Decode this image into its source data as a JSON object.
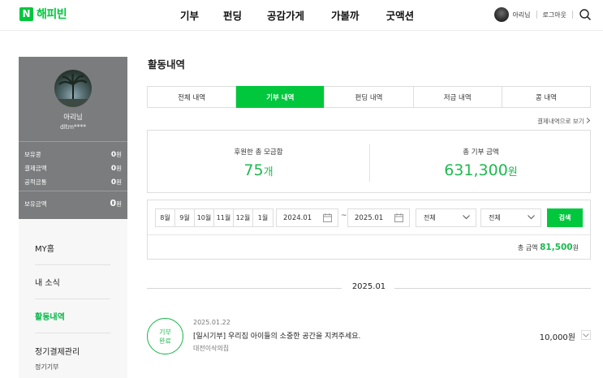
{
  "header": {
    "logo_mark": "N",
    "logo_text": "해피빈",
    "nav": [
      "기부",
      "펀딩",
      "공감가게",
      "가볼까",
      "굿액션"
    ],
    "user_name": "아리님",
    "logout_label": "로그아웃"
  },
  "profile": {
    "name": "아리님",
    "id": "dltm****",
    "stats": [
      {
        "label": "보유콩",
        "value": "0",
        "unit": "원"
      },
      {
        "label": "결제금액",
        "value": "0",
        "unit": "원"
      },
      {
        "label": "공적금통",
        "value": "0",
        "unit": "원"
      }
    ],
    "total": {
      "label": "보유금액",
      "value": "0",
      "unit": "원"
    }
  },
  "menu": {
    "items": [
      "MY홈",
      "내 소식",
      "활동내역",
      "정기결제관리"
    ],
    "active": "활동내역",
    "sub": "정기기부"
  },
  "main": {
    "title": "활동내역",
    "tabs": [
      "전체 내역",
      "기부 내역",
      "펀딩 내역",
      "저금 내역",
      "콩 내역"
    ],
    "active_tab": "기부 내역",
    "payment_link": "결제내역으로 보기",
    "summary": [
      {
        "label": "후원한 총 모금함",
        "value": "75",
        "unit": "개"
      },
      {
        "label": "총 기부 금액",
        "value": "631,300",
        "unit": "원"
      }
    ],
    "filter": {
      "months": [
        "8월",
        "9월",
        "10월",
        "11월",
        "12월",
        "1월"
      ],
      "start_date": "2024.01",
      "end_date": "2025.01",
      "tilde": "~",
      "select1": "전체",
      "select2": "전체",
      "search_label": "검색",
      "total_label": "총 금액",
      "total_value": "81,500",
      "total_unit": "원"
    },
    "month_header": "2025.01",
    "donations": [
      {
        "badge_line1": "기부",
        "badge_line2": "완료",
        "date": "2025.01.22",
        "title": "[일시기부] 우리집 아이들의 소중한 공간을 지켜주세요.",
        "org": "대전이삭의집",
        "amount": "10,000원"
      }
    ]
  },
  "colors": {
    "brand": "#00c73c",
    "accent_text": "#1eb950",
    "profile_bg": "#7a7c7d"
  }
}
